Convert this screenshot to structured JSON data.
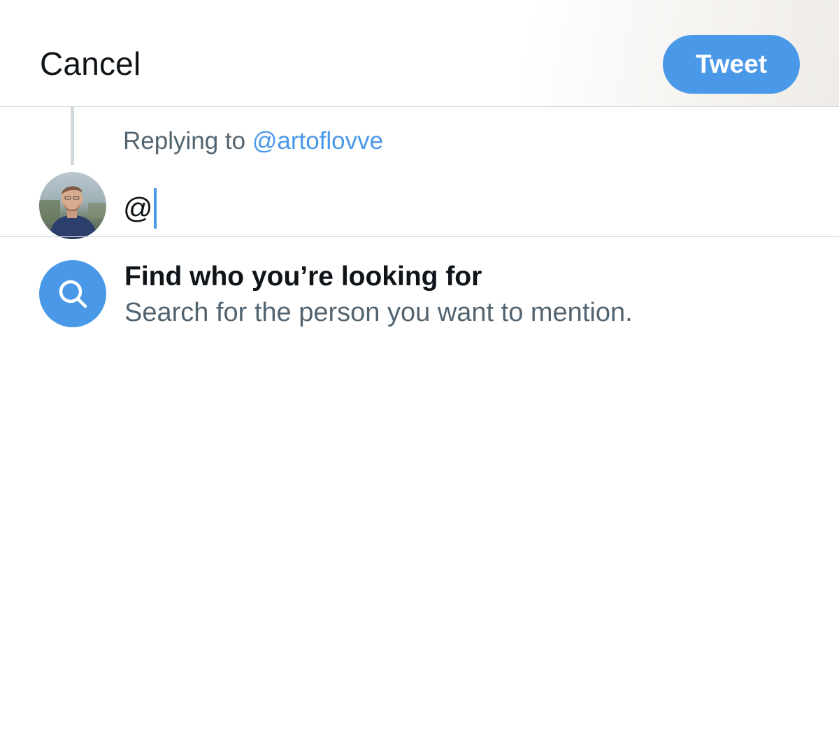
{
  "header": {
    "cancel_label": "Cancel",
    "tweet_label": "Tweet"
  },
  "reply": {
    "prefix": "Replying to ",
    "handle": "@artoflovve"
  },
  "compose": {
    "value": "@"
  },
  "suggestion": {
    "title": "Find who you’re looking for",
    "subtitle": "Search for the person you want to mention.",
    "icon": "search-icon"
  },
  "colors": {
    "accent": "#4a98e8",
    "text_primary": "#0f1419",
    "text_secondary": "#536471",
    "divider": "#cfd9de"
  }
}
